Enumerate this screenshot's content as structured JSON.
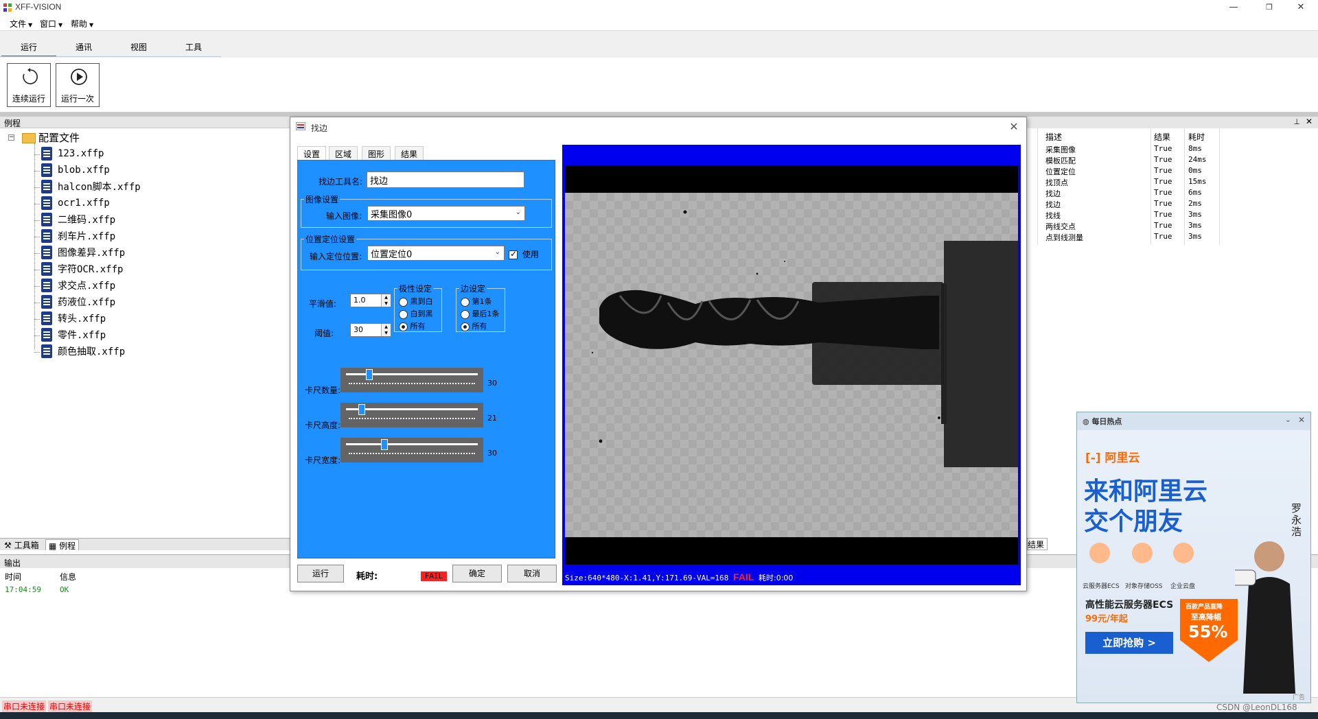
{
  "window": {
    "title": "XFF-VISION"
  },
  "menu": [
    {
      "label": "文件"
    },
    {
      "label": "窗口"
    },
    {
      "label": "帮助"
    }
  ],
  "ribbon": {
    "tabs": [
      "运行",
      "通讯",
      "视图",
      "工具"
    ],
    "buttons": [
      {
        "label": "连续运行"
      },
      {
        "label": "运行一次"
      }
    ]
  },
  "left_panel": {
    "title": "例程",
    "root": "配置文件",
    "files": [
      "123.xffp",
      "blob.xffp",
      "halcon脚本.xffp",
      "ocr1.xffp",
      "二维码.xffp",
      "刹车片.xffp",
      "图像差异.xffp",
      "字符OCR.xffp",
      "求交点.xffp",
      "药液位.xffp",
      "转头.xffp",
      "零件.xffp",
      "颜色抽取.xffp"
    ],
    "tabs": [
      "工具箱",
      "例程"
    ]
  },
  "output": {
    "title": "输出",
    "columns": [
      "时间",
      "信息"
    ],
    "rows": [
      {
        "time": "17:04:59",
        "info": "OK"
      }
    ]
  },
  "status": {
    "serial1": "串口未连接",
    "serial2": "串口未连接"
  },
  "results": {
    "columns": [
      "描述",
      "结果",
      "耗时"
    ],
    "rows": [
      {
        "desc": "采集图像",
        "result": "True",
        "time": "8ms"
      },
      {
        "desc": "模板匹配",
        "result": "True",
        "time": "24ms"
      },
      {
        "desc": "位置定位",
        "result": "True",
        "time": "0ms"
      },
      {
        "desc": "找顶点",
        "result": "True",
        "time": "15ms"
      },
      {
        "desc": "找边",
        "result": "True",
        "time": "6ms"
      },
      {
        "desc": "找边",
        "result": "True",
        "time": "2ms"
      },
      {
        "desc": "找线",
        "result": "True",
        "time": "3ms"
      },
      {
        "desc": "两线交点",
        "result": "True",
        "time": "3ms"
      },
      {
        "desc": "点到线测量",
        "result": "True",
        "time": "3ms"
      }
    ],
    "tab": "结果"
  },
  "dialog": {
    "title": "找边",
    "tabs": [
      "设置",
      "区域",
      "图形",
      "结果"
    ],
    "tool_name_label": "找边工具名:",
    "tool_name_value": "找边",
    "image_group": "图像设置",
    "input_image_label": "输入图像:",
    "input_image_value": "采集图像0",
    "position_group": "位置定位设置",
    "input_position_label": "输入定位位置:",
    "input_position_value": "位置定位0",
    "use_label": "使用",
    "smooth_label": "平滑值:",
    "smooth_value": "1.0",
    "threshold_label": "阈值:",
    "threshold_value": "30",
    "polarity_group": "极性设定",
    "polarity_options": [
      "黑到白",
      "白到黑",
      "所有"
    ],
    "edge_group": "边设定",
    "edge_options": [
      "第1条",
      "最后1条",
      "所有"
    ],
    "sliders": [
      {
        "label": "卡尺数量:",
        "value": "30",
        "fraction": 0.16
      },
      {
        "label": "卡尺高度:",
        "value": "21",
        "fraction": 0.1
      },
      {
        "label": "卡尺宽度:",
        "value": "30",
        "fraction": 0.28
      }
    ],
    "run_button": "运行",
    "elapsed_label": "耗时:",
    "fail_badge": "FAIL",
    "ok_button": "确定",
    "cancel_button": "取消",
    "image_status": "Size:640*480-X:1.41,Y:171.69-VAL=168",
    "image_fail": "FAIL",
    "image_time": "耗时:0:00"
  },
  "ad": {
    "header": "每日热点",
    "brand": "阿里云",
    "headline1": "来和阿里云",
    "headline2": "交个朋友",
    "person": "罗永浩",
    "icons": [
      "云服务器ECS",
      "对象存储OSS",
      "企业云盘"
    ],
    "offer": "高性能云服务器ECS",
    "price": "99元/年起",
    "cta": "立即抢购 >",
    "badge1": "百款产品直降",
    "badge2": "至高降幅",
    "badge3": "55%",
    "ad_label": "广告"
  },
  "watermark": "CSDN @LeonDL168"
}
